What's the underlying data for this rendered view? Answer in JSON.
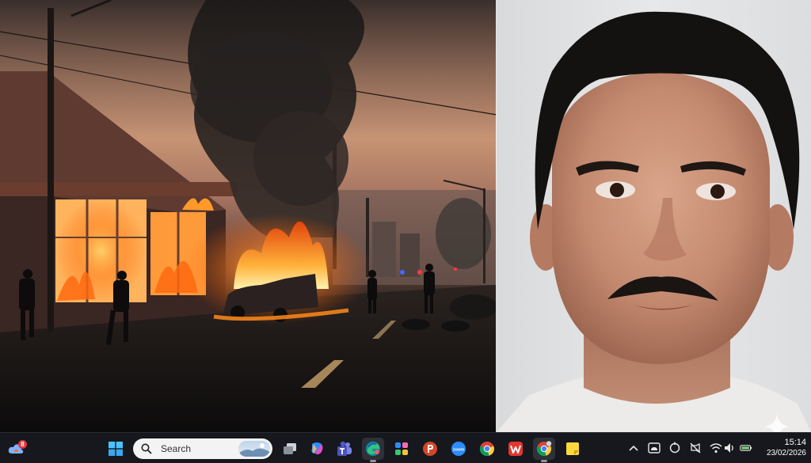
{
  "taskbar": {
    "search_label": "Search",
    "widget_badge": "8",
    "clock_time": "15:14",
    "clock_date": "23/02/2026",
    "pinned_apps": [
      "start-button",
      "search",
      "task-view",
      "copilot",
      "teams",
      "edge",
      "copilot-app",
      "powerpoint",
      "zoom",
      "chrome",
      "wps-office",
      "chrome-profile",
      "sticky-notes"
    ]
  },
  "tray": {
    "icons": [
      "chevron-up-icon",
      "cloud-icon",
      "sync-icon",
      "meet-mute-icon",
      "wifi-icon",
      "volume-icon",
      "battery-icon"
    ]
  },
  "colors": {
    "taskbar_bg": "#16181d",
    "fire": "#ff8a1c",
    "sky": "#c79374"
  }
}
